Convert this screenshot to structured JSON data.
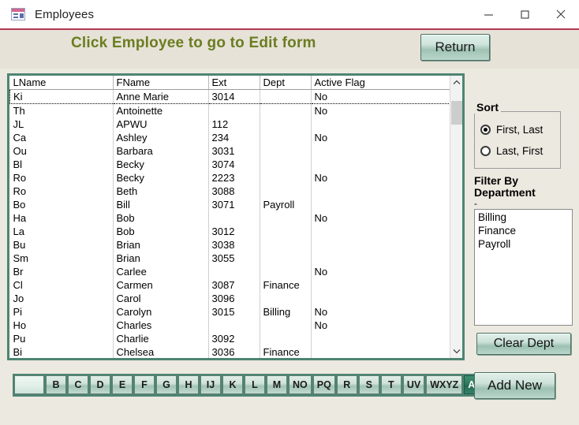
{
  "window": {
    "title": "Employees",
    "icon": "access-form-icon",
    "controls": {
      "minimize": "minimize-icon",
      "maximize": "maximize-icon",
      "close": "close-icon"
    }
  },
  "banner": {
    "title": "Click Employee to go to Edit form",
    "return_label": "Return",
    "title_color": "#6b7d20",
    "background": "#e6e2d8"
  },
  "grid": {
    "columns": [
      "LName",
      "FName",
      "Ext",
      "Dept",
      "Active Flag"
    ],
    "selected_row_index": 0,
    "rows": [
      {
        "lname": "Ki",
        "fname": "Anne Marie",
        "ext": "3014",
        "dept": "",
        "active": "No"
      },
      {
        "lname": "Th",
        "fname": "Antoinette",
        "ext": "",
        "dept": "",
        "active": "No"
      },
      {
        "lname": "JL",
        "fname": "APWU",
        "ext": "112",
        "dept": "",
        "active": ""
      },
      {
        "lname": "Ca",
        "fname": "Ashley",
        "ext": "234",
        "dept": "",
        "active": "No"
      },
      {
        "lname": "Ou",
        "fname": "Barbara",
        "ext": "3031",
        "dept": "",
        "active": ""
      },
      {
        "lname": "Bl",
        "fname": "Becky",
        "ext": "3074",
        "dept": "",
        "active": ""
      },
      {
        "lname": "Ro",
        "fname": "Becky",
        "ext": "2223",
        "dept": "",
        "active": "No"
      },
      {
        "lname": "Ro",
        "fname": "Beth",
        "ext": "3088",
        "dept": "",
        "active": ""
      },
      {
        "lname": "Bo",
        "fname": "Bill",
        "ext": "3071",
        "dept": "Payroll",
        "active": ""
      },
      {
        "lname": "Ha",
        "fname": "Bob",
        "ext": "",
        "dept": "",
        "active": "No"
      },
      {
        "lname": "La",
        "fname": "Bob",
        "ext": "3012",
        "dept": "",
        "active": ""
      },
      {
        "lname": "Bu",
        "fname": "Brian",
        "ext": "3038",
        "dept": "",
        "active": ""
      },
      {
        "lname": "Sm",
        "fname": "Brian",
        "ext": "3055",
        "dept": "",
        "active": ""
      },
      {
        "lname": "Br",
        "fname": "Carlee",
        "ext": "",
        "dept": "",
        "active": "No"
      },
      {
        "lname": "Cl",
        "fname": "Carmen",
        "ext": "3087",
        "dept": "Finance",
        "active": ""
      },
      {
        "lname": "Jo",
        "fname": "Carol",
        "ext": "3096",
        "dept": "",
        "active": ""
      },
      {
        "lname": "Pi",
        "fname": "Carolyn",
        "ext": "3015",
        "dept": "Billing",
        "active": "No"
      },
      {
        "lname": "Ho",
        "fname": "Charles",
        "ext": "",
        "dept": "",
        "active": "No"
      },
      {
        "lname": "Pu",
        "fname": "Charlie",
        "ext": "3092",
        "dept": "",
        "active": ""
      },
      {
        "lname": "Bi",
        "fname": "Chelsea",
        "ext": "3036",
        "dept": "Finance",
        "active": ""
      }
    ]
  },
  "scrollbar": {
    "up_icon": "chevron-up-icon",
    "down_icon": "chevron-down-icon",
    "thumb_position_percent": 5
  },
  "sort": {
    "legend": "Sort",
    "options": [
      {
        "label": "First, Last",
        "selected": true
      },
      {
        "label": "Last, First",
        "selected": false
      }
    ]
  },
  "filter": {
    "label": "Filter By Department",
    "dash": "-",
    "departments": [
      "Billing",
      "Finance",
      "Payroll"
    ],
    "clear_label": "Clear Dept"
  },
  "alpha_bar": {
    "buttons": [
      {
        "label": "",
        "selected": false,
        "blank": true
      },
      {
        "label": "B",
        "selected": false
      },
      {
        "label": "C",
        "selected": false
      },
      {
        "label": "D",
        "selected": false
      },
      {
        "label": "E",
        "selected": false
      },
      {
        "label": "F",
        "selected": false
      },
      {
        "label": "G",
        "selected": false
      },
      {
        "label": "H",
        "selected": false
      },
      {
        "label": "IJ",
        "selected": false
      },
      {
        "label": "K",
        "selected": false
      },
      {
        "label": "L",
        "selected": false
      },
      {
        "label": "M",
        "selected": false
      },
      {
        "label": "NO",
        "selected": false
      },
      {
        "label": "PQ",
        "selected": false
      },
      {
        "label": "R",
        "selected": false
      },
      {
        "label": "S",
        "selected": false
      },
      {
        "label": "T",
        "selected": false
      },
      {
        "label": "UV",
        "selected": false
      },
      {
        "label": "WXYZ",
        "selected": false
      },
      {
        "label": "A-Z",
        "selected": true
      }
    ],
    "bar_color": "#4d8573"
  },
  "add_new": {
    "label": "Add New"
  },
  "theme": {
    "accent_green": "#4d8573",
    "title_underline": "#b03a50",
    "page_bg": "#ece9e0"
  }
}
